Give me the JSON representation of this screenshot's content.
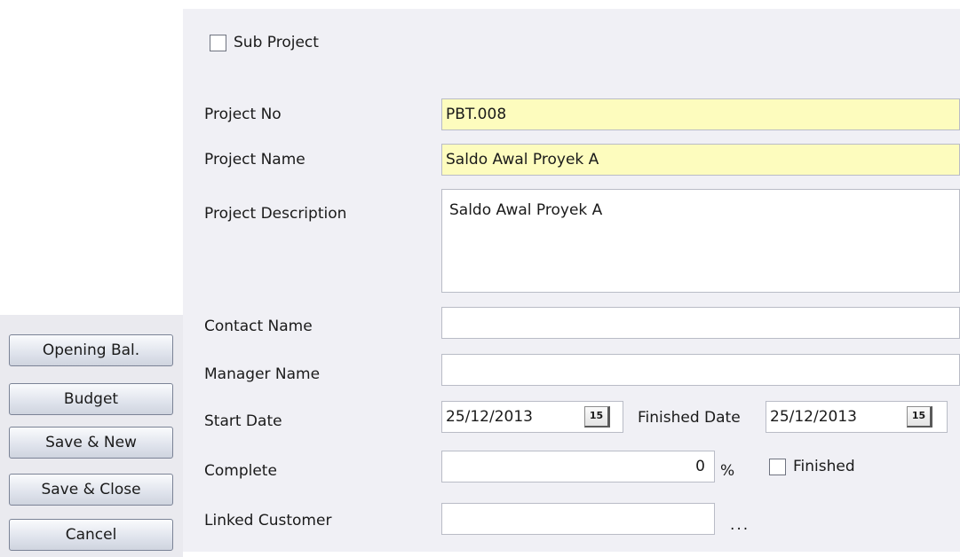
{
  "sub_project": {
    "label": "Sub Project",
    "checked": false
  },
  "fields": {
    "project_no": {
      "label": "Project No",
      "value": "PBT.008"
    },
    "project_name": {
      "label": "Project Name",
      "value": "Saldo Awal Proyek A"
    },
    "project_description": {
      "label": "Project Description",
      "value": "Saldo Awal Proyek A"
    },
    "contact_name": {
      "label": "Contact Name",
      "value": ""
    },
    "manager_name": {
      "label": "Manager Name",
      "value": ""
    },
    "start_date": {
      "label": "Start Date",
      "value": "25/12/2013"
    },
    "finished_date": {
      "label": "Finished Date",
      "value": "25/12/2013"
    },
    "complete": {
      "label": "Complete",
      "value": "0",
      "unit": "%"
    },
    "finished": {
      "label": "Finished",
      "checked": false
    },
    "linked_customer": {
      "label": "Linked Customer",
      "value": "",
      "browse": "..."
    }
  },
  "calendar_icon_glyph": "15",
  "buttons": {
    "opening_bal": "Opening Bal.",
    "budget": "Budget",
    "save_new": "Save & New",
    "save_close": "Save & Close",
    "cancel": "Cancel"
  },
  "colors": {
    "required_field": "#fdfcbe",
    "panel": "#f0f0f5"
  }
}
